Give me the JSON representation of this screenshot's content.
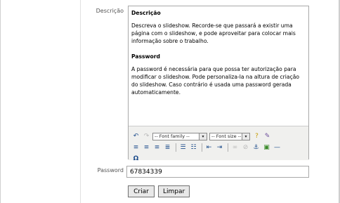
{
  "form": {
    "description_label": "Descrição",
    "password_label": "Password",
    "password_value": "67834339",
    "submit_label": "Criar",
    "reset_label": "Limpar"
  },
  "editor": {
    "heading1": "Descrição",
    "para1": "Descreva o slideshow. Recorde-se que passará a existir uma página com o slideshow, e pode aproveitar para colocar mais informação sobre o trabalho.",
    "heading2": "Password",
    "para2": "A password é necessária para que possa ter autorização para modificar o slideshow. Pode personaliza-la na altura de criação do slideshow. Caso contrário é usada uma password gerada automaticamente.",
    "font_family_placeholder": "-- Font family --",
    "font_size_placeholder": "-- Font size --"
  },
  "icons": {
    "undo": "undo-icon",
    "redo": "redo-icon",
    "help": "help-icon",
    "clean": "cleanup-icon",
    "align_left": "align-left-icon",
    "align_center": "align-center-icon",
    "align_right": "align-right-icon",
    "justify": "justify-icon",
    "bullets": "bullet-list-icon",
    "numbers": "numbered-list-icon",
    "outdent": "outdent-icon",
    "indent": "indent-icon",
    "link": "link-icon",
    "unlink": "unlink-icon",
    "anchor": "anchor-icon",
    "image": "image-icon",
    "hr": "horizontal-rule-icon",
    "omega": "special-char-icon"
  },
  "colors": {
    "accent": "#1f4e8c",
    "label": "#555555"
  }
}
